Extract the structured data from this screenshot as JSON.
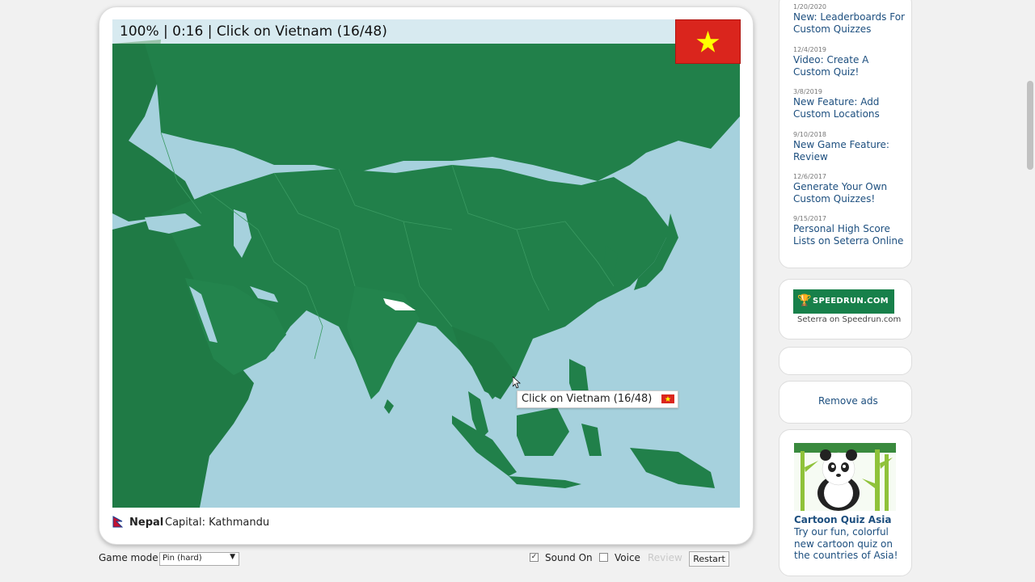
{
  "quiz": {
    "status_text": "100% | 0:16 | Click on Vietnam (16/48)",
    "target_country": "Vietnam",
    "tooltip_text": "Click on Vietnam (16/48)"
  },
  "last_answer": {
    "country": "Nepal",
    "capital_text": "Capital: Kathmandu"
  },
  "controls": {
    "game_mode_label": "Game mode:",
    "game_mode_value": "Pin (hard)",
    "sound_label": "Sound On",
    "sound_checked": true,
    "voice_label": "Voice",
    "voice_checked": false,
    "review_label": "Review",
    "restart_label": "Restart"
  },
  "news": [
    {
      "date": "1/20/2020",
      "title": "New: Leaderboards For Custom Quizzes"
    },
    {
      "date": "12/4/2019",
      "title": "Video: Create A Custom Quiz!"
    },
    {
      "date": "3/8/2019",
      "title": "New Feature: Add Custom Locations"
    },
    {
      "date": "9/10/2018",
      "title": "New Game Feature: Review"
    },
    {
      "date": "12/6/2017",
      "title": "Generate Your Own Custom Quizzes!"
    },
    {
      "date": "9/15/2017",
      "title": "Personal High Score Lists on Seterra Online"
    }
  ],
  "sidebar": {
    "speedrun_logo": "SPEEDRUN.COM",
    "speedrun_caption": "Seterra on Speedrun.com",
    "remove_ads": "Remove ads",
    "promo_title": "Cartoon Quiz Asia",
    "promo_desc": "Try our fun, colorful new cartoon quiz on the countries of Asia!"
  },
  "colors": {
    "land": "#21804a",
    "land_dark": "#1a6e3e",
    "water": "#a6d1dd",
    "answered": "#ffffff",
    "link": "#1d4f7f",
    "flag_red": "#da251d",
    "flag_star": "#ffff00"
  }
}
